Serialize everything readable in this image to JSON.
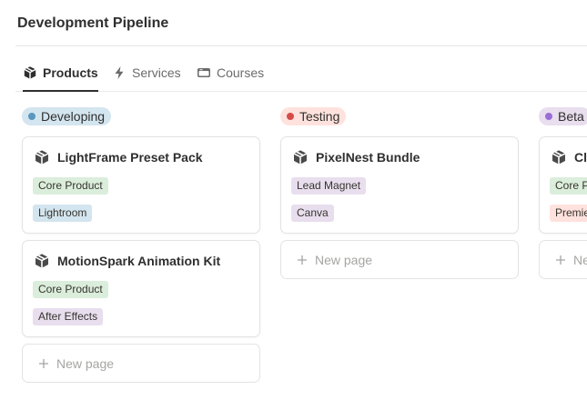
{
  "page": {
    "title": "Development Pipeline"
  },
  "tabs": [
    {
      "label": "Products",
      "icon": "package-icon",
      "active": true
    },
    {
      "label": "Services",
      "icon": "lightning-icon",
      "active": false
    },
    {
      "label": "Courses",
      "icon": "card-icon",
      "active": false
    }
  ],
  "columns": [
    {
      "status": "Developing",
      "pill_color": "#d3e5ef",
      "dot_color": "#5b97bd",
      "cards": [
        {
          "title": "LightFrame Preset Pack",
          "icon": "package-icon",
          "tags": [
            {
              "label": "Core Product",
              "color": "#dbeddb"
            },
            {
              "label": "Lightroom",
              "color": "#d3e5ef"
            }
          ]
        },
        {
          "title": "MotionSpark Animation Kit",
          "icon": "package-icon",
          "tags": [
            {
              "label": "Core Product",
              "color": "#dbeddb"
            },
            {
              "label": "After Effects",
              "color": "#e8deee"
            }
          ]
        }
      ],
      "new_page_label": "New page"
    },
    {
      "status": "Testing",
      "pill_color": "#ffe2dd",
      "dot_color": "#d44c47",
      "cards": [
        {
          "title": "PixelNest Bundle",
          "icon": "package-icon",
          "tags": [
            {
              "label": "Lead Magnet",
              "color": "#e8deee"
            },
            {
              "label": "Canva",
              "color": "#e8deee"
            }
          ]
        }
      ],
      "new_page_label": "New page"
    },
    {
      "status": "Beta",
      "pill_color": "#e8deee",
      "dot_color": "#9a6dd7",
      "cards": [
        {
          "title": "Cli",
          "icon": "package-icon",
          "tags": [
            {
              "label": "Core P",
              "color": "#dbeddb"
            },
            {
              "label": "Premie",
              "color": "#ffe2dd"
            }
          ]
        }
      ],
      "new_page_label": "Ne"
    }
  ]
}
